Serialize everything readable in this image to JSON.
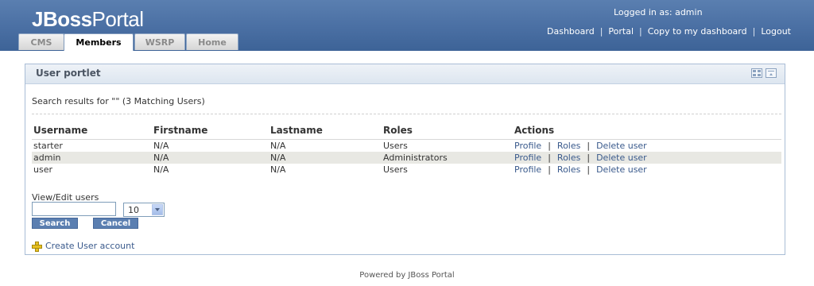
{
  "header": {
    "logo_bold": "JBoss",
    "logo_light": "Portal",
    "logged_in": "Logged in as: admin",
    "links": [
      "Dashboard",
      "Portal",
      "Copy to my dashboard",
      "Logout"
    ],
    "link_separator": "|",
    "tabs": [
      {
        "label": "CMS",
        "active": false
      },
      {
        "label": "Members",
        "active": true
      },
      {
        "label": "WSRP",
        "active": false
      },
      {
        "label": "Home",
        "active": false
      }
    ]
  },
  "portlet": {
    "title": "User portlet",
    "window_icons": [
      "maximize-icon",
      "minimize-icon"
    ],
    "results_text": "Search results for \"\" (3 Matching Users)",
    "columns": [
      "Username",
      "Firstname",
      "Lastname",
      "Roles",
      "Actions"
    ],
    "rows": [
      {
        "username": "starter",
        "firstname": "N/A",
        "lastname": "N/A",
        "roles": "Users"
      },
      {
        "username": "admin",
        "firstname": "N/A",
        "lastname": "N/A",
        "roles": "Administrators"
      },
      {
        "username": "user",
        "firstname": "N/A",
        "lastname": "N/A",
        "roles": "Users"
      }
    ],
    "actions": {
      "profile": "Profile",
      "roles": "Roles",
      "delete": "Delete user",
      "separator": "|"
    },
    "view_edit_label": "View/Edit users",
    "search_value": "",
    "page_size": "10",
    "search_button": "Search",
    "cancel_button": "Cancel",
    "create_label": "Create User account"
  },
  "footer": {
    "text": "Powered by JBoss Portal"
  },
  "colors": {
    "header": "#4a6fa3",
    "link": "#3a5a8c",
    "button": "#5b7fb1"
  }
}
